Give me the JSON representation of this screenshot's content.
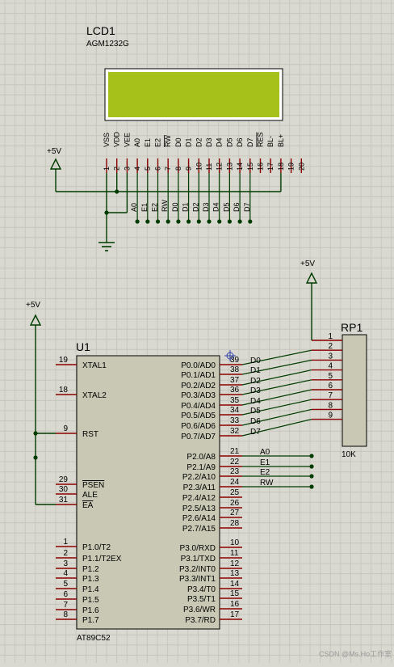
{
  "colors": {
    "background": "#d9d9d1",
    "grid": "#c6c6bd",
    "wire": "#003c00",
    "pin": "#8b0000",
    "body_fill": "#c8c8b4",
    "lcd_screen": "#a6c21a",
    "junction": "#003c00",
    "power": "#003c00"
  },
  "lcd": {
    "ref": "LCD1",
    "part": "AGM1232G",
    "pins": [
      {
        "num": "1",
        "name": "VSS",
        "overline": false
      },
      {
        "num": "2",
        "name": "VDD",
        "overline": false
      },
      {
        "num": "3",
        "name": "VEE",
        "overline": false
      },
      {
        "num": "4",
        "name": "A0",
        "overline": false
      },
      {
        "num": "5",
        "name": "E1",
        "overline": false
      },
      {
        "num": "6",
        "name": "E2",
        "overline": false
      },
      {
        "num": "7",
        "name": "RW",
        "overline": true
      },
      {
        "num": "8",
        "name": "D0",
        "overline": false
      },
      {
        "num": "9",
        "name": "D1",
        "overline": false
      },
      {
        "num": "10",
        "name": "D2",
        "overline": false
      },
      {
        "num": "11",
        "name": "D3",
        "overline": false
      },
      {
        "num": "12",
        "name": "D4",
        "overline": false
      },
      {
        "num": "13",
        "name": "D5",
        "overline": false
      },
      {
        "num": "14",
        "name": "D6",
        "overline": false
      },
      {
        "num": "15",
        "name": "D7",
        "overline": false
      },
      {
        "num": "16",
        "name": "RES",
        "overline": true
      },
      {
        "num": "17",
        "name": "BL-",
        "overline": false
      },
      {
        "num": "18",
        "name": "BL+",
        "overline": false
      },
      {
        "num": "19",
        "name": "",
        "overline": false
      },
      {
        "num": "20",
        "name": "",
        "overline": false
      }
    ],
    "net_labels": [
      "A0",
      "E1",
      "E2",
      "RW",
      "D0",
      "D1",
      "D2",
      "D3",
      "D4",
      "D5",
      "D6",
      "D7"
    ]
  },
  "power": {
    "lcd_supply": "+5V",
    "rp1_supply": "+5V",
    "u1_supply": "+5V"
  },
  "rp1": {
    "ref": "RP1",
    "value": "10K",
    "pins": [
      "1",
      "2",
      "3",
      "4",
      "5",
      "6",
      "7",
      "8",
      "9"
    ]
  },
  "u1": {
    "ref": "U1",
    "part": "AT89C52",
    "left_pins": [
      {
        "num": "19",
        "name": "XTAL1"
      },
      {
        "num": "18",
        "name": "XTAL2"
      },
      {
        "num": "9",
        "name": "RST"
      },
      {
        "num": "29",
        "name": "PSEN"
      },
      {
        "num": "30",
        "name": "ALE"
      },
      {
        "num": "31",
        "name": "EA"
      },
      {
        "num": "1",
        "name": "P1.0/T2"
      },
      {
        "num": "2",
        "name": "P1.1/T2EX"
      },
      {
        "num": "3",
        "name": "P1.2"
      },
      {
        "num": "4",
        "name": "P1.3"
      },
      {
        "num": "5",
        "name": "P1.4"
      },
      {
        "num": "6",
        "name": "P1.5"
      },
      {
        "num": "7",
        "name": "P1.6"
      },
      {
        "num": "8",
        "name": "P1.7"
      }
    ],
    "right_pins": [
      {
        "num": "39",
        "name": "P0.0/AD0",
        "net": "D0"
      },
      {
        "num": "38",
        "name": "P0.1/AD1",
        "net": "D1"
      },
      {
        "num": "37",
        "name": "P0.2/AD2",
        "net": "D2"
      },
      {
        "num": "36",
        "name": "P0.3/AD3",
        "net": "D3"
      },
      {
        "num": "35",
        "name": "P0.4/AD4",
        "net": "D4"
      },
      {
        "num": "34",
        "name": "P0.5/AD5",
        "net": "D5"
      },
      {
        "num": "33",
        "name": "P0.6/AD6",
        "net": "D6"
      },
      {
        "num": "32",
        "name": "P0.7/AD7",
        "net": "D7"
      },
      {
        "num": "21",
        "name": "P2.0/A8",
        "net": "A0"
      },
      {
        "num": "22",
        "name": "P2.1/A9",
        "net": "E1"
      },
      {
        "num": "23",
        "name": "P2.2/A10",
        "net": "E2"
      },
      {
        "num": "24",
        "name": "P2.3/A11",
        "net": "RW"
      },
      {
        "num": "25",
        "name": "P2.4/A12",
        "net": ""
      },
      {
        "num": "26",
        "name": "P2.5/A13",
        "net": ""
      },
      {
        "num": "27",
        "name": "P2.6/A14",
        "net": ""
      },
      {
        "num": "28",
        "name": "P2.7/A15",
        "net": ""
      },
      {
        "num": "10",
        "name": "P3.0/RXD",
        "net": ""
      },
      {
        "num": "11",
        "name": "P3.1/TXD",
        "net": ""
      },
      {
        "num": "12",
        "name": "P3.2/INT0",
        "net": ""
      },
      {
        "num": "13",
        "name": "P3.3/INT1",
        "net": ""
      },
      {
        "num": "14",
        "name": "P3.4/T0",
        "net": ""
      },
      {
        "num": "15",
        "name": "P3.5/T1",
        "net": ""
      },
      {
        "num": "16",
        "name": "P3.6/WR",
        "net": ""
      },
      {
        "num": "17",
        "name": "P3.7/RD",
        "net": ""
      }
    ]
  },
  "watermark": "CSDN @Ms.Ho工作室"
}
